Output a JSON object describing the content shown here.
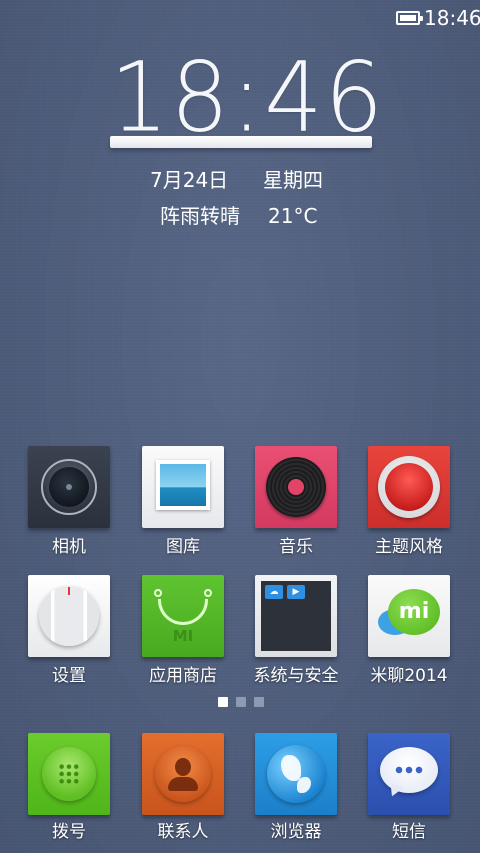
{
  "status_bar": {
    "battery_icon": "battery-full-icon",
    "time": "18:46"
  },
  "clock_widget": {
    "time": "18:46",
    "date": "7月24日",
    "weekday": "星期四",
    "weather": "阵雨转晴",
    "temperature": "21°C"
  },
  "apps_row1": [
    {
      "label": "相机",
      "icon": "camera-icon"
    },
    {
      "label": "图库",
      "icon": "gallery-icon"
    },
    {
      "label": "音乐",
      "icon": "music-icon"
    },
    {
      "label": "主题风格",
      "icon": "theme-icon"
    }
  ],
  "apps_row2": [
    {
      "label": "设置",
      "icon": "settings-icon"
    },
    {
      "label": "应用商店",
      "icon": "app-store-icon",
      "logo_text": "MI"
    },
    {
      "label": "系统与安全",
      "icon": "security-folder-icon"
    },
    {
      "label": "米聊2014",
      "icon": "mitalk-icon",
      "logo_text": "mi"
    }
  ],
  "dock": [
    {
      "label": "拨号",
      "icon": "phone-icon"
    },
    {
      "label": "联系人",
      "icon": "contacts-icon"
    },
    {
      "label": "浏览器",
      "icon": "browser-icon"
    },
    {
      "label": "短信",
      "icon": "sms-icon"
    }
  ],
  "pager": {
    "pages": 3,
    "current": 1
  },
  "colors": {
    "wallpaper": "#4f5f80",
    "pager_active": "#ffffff",
    "pager_inactive": "#8e9ab2"
  }
}
